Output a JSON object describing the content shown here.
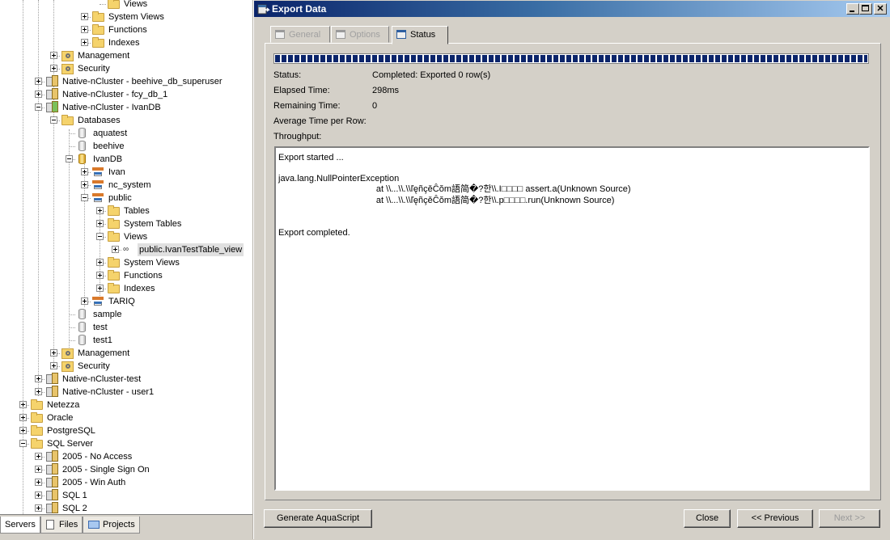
{
  "tree": {
    "items": [
      {
        "label": "Views",
        "icon": "folder-icon"
      },
      {
        "label": "System Views",
        "icon": "folder-icon"
      },
      {
        "label": "Functions",
        "icon": "folder-icon"
      },
      {
        "label": "Indexes",
        "icon": "folder-icon"
      },
      {
        "label": "Management",
        "icon": "management-icon"
      },
      {
        "label": "Security",
        "icon": "security-icon"
      },
      {
        "label": "Native-nCluster - beehive_db_superuser",
        "icon": "server-icon"
      },
      {
        "label": "Native-nCluster - fcy_db_1",
        "icon": "server-icon"
      },
      {
        "label": "Native-nCluster - IvanDB",
        "icon": "server-connected-icon"
      },
      {
        "label": "Databases",
        "icon": "folder-icon"
      },
      {
        "label": "aquatest",
        "icon": "database-icon"
      },
      {
        "label": "beehive",
        "icon": "database-icon"
      },
      {
        "label": "IvanDB",
        "icon": "database-icon"
      },
      {
        "label": "Ivan",
        "icon": "schema-icon"
      },
      {
        "label": "nc_system",
        "icon": "schema-icon"
      },
      {
        "label": "public",
        "icon": "schema-icon"
      },
      {
        "label": "Tables",
        "icon": "folder-icon"
      },
      {
        "label": "System Tables",
        "icon": "folder-icon"
      },
      {
        "label": "Views",
        "icon": "folder-icon"
      },
      {
        "label": "public.IvanTestTable_view",
        "icon": "view-icon"
      },
      {
        "label": "System Views",
        "icon": "folder-icon"
      },
      {
        "label": "Functions",
        "icon": "folder-icon"
      },
      {
        "label": "Indexes",
        "icon": "folder-icon"
      },
      {
        "label": "TARIQ",
        "icon": "schema-icon"
      },
      {
        "label": "sample",
        "icon": "database-icon"
      },
      {
        "label": "test",
        "icon": "database-icon"
      },
      {
        "label": "test1",
        "icon": "database-icon"
      },
      {
        "label": "Management",
        "icon": "management-icon"
      },
      {
        "label": "Security",
        "icon": "security-icon"
      },
      {
        "label": "Native-nCluster-test",
        "icon": "server-icon"
      },
      {
        "label": "Native-nCluster - user1",
        "icon": "server-icon"
      },
      {
        "label": "Netezza",
        "icon": "folder-icon"
      },
      {
        "label": "Oracle",
        "icon": "folder-icon"
      },
      {
        "label": "PostgreSQL",
        "icon": "folder-icon"
      },
      {
        "label": "SQL Server",
        "icon": "folder-icon"
      },
      {
        "label": "2005 - No Access",
        "icon": "server-icon"
      },
      {
        "label": "2005 - Single Sign On",
        "icon": "server-icon"
      },
      {
        "label": "2005 - Win Auth",
        "icon": "server-icon"
      },
      {
        "label": "SQL 1",
        "icon": "server-icon"
      },
      {
        "label": "SQL 2",
        "icon": "server-icon"
      }
    ]
  },
  "bottom_tabs": [
    {
      "label": "Servers"
    },
    {
      "label": "Files"
    },
    {
      "label": "Projects"
    }
  ],
  "dialog": {
    "title": "Export Data",
    "tabs": [
      {
        "label": "General"
      },
      {
        "label": "Options"
      },
      {
        "label": "Status"
      }
    ],
    "progress": 1.0,
    "fields": [
      {
        "label": "Status:",
        "value": "Completed: Exported 0 row(s)"
      },
      {
        "label": "Elapsed Time:",
        "value": "298ms"
      },
      {
        "label": "Remaining Time:",
        "value": "0"
      },
      {
        "label": "Average Time per Row:",
        "value": ""
      },
      {
        "label": "Throughput:",
        "value": ""
      }
    ],
    "log": [
      "Export started ...",
      "",
      "java.lang.NullPointerException",
      "\t\tat \\\\...\\\\.\\\\ľęñçěĈŏm語简�?한\\\\.I□□□□ assert.a(Unknown Source)",
      "\t\tat \\\\...\\\\.\\\\ľęñçěĈŏm語简�?한\\\\.p□□□□.run(Unknown Source)",
      "",
      "",
      "Export completed."
    ],
    "buttons": {
      "generate": "Generate AquaScript",
      "close": "Close",
      "previous": "<< Previous",
      "next": "Next >>"
    }
  },
  "colors": {
    "title_start": "#0a246a",
    "title_end": "#a6caf0",
    "progress": "#0a246a",
    "face": "#d4d0c8"
  }
}
